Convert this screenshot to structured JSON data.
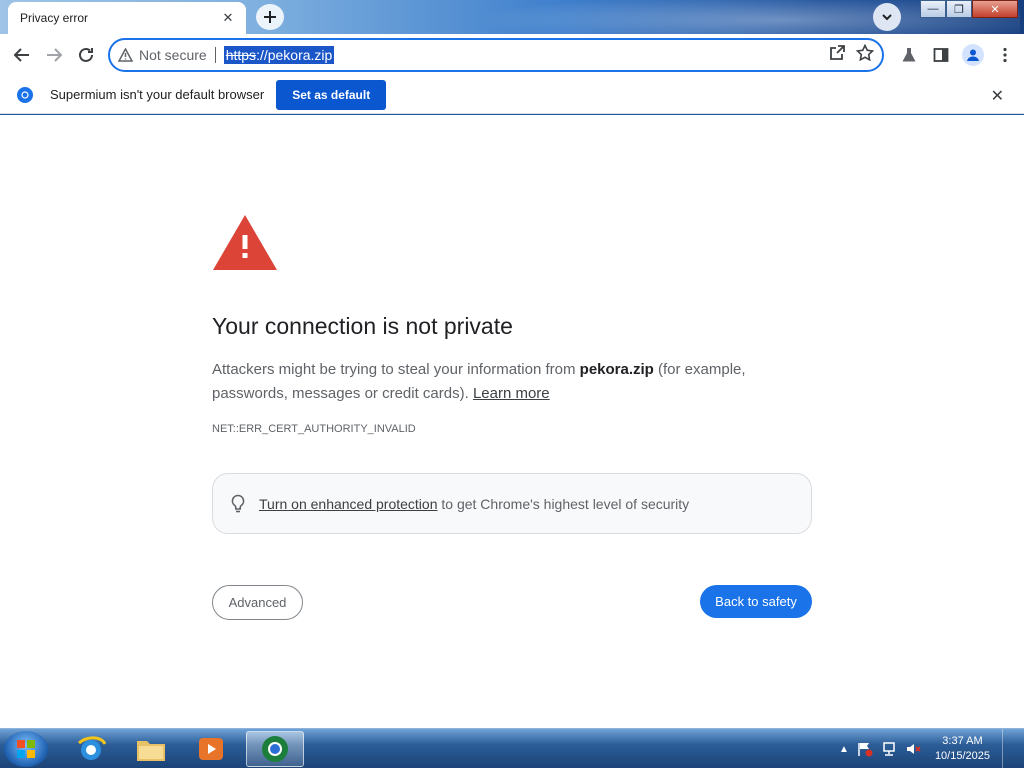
{
  "tab": {
    "title": "Privacy error",
    "close": "✕"
  },
  "window_controls": {
    "minimize": "—",
    "maximize": "❐",
    "close": "✕"
  },
  "omnibox": {
    "security_label": "Not secure",
    "url_scheme": "https",
    "url_rest": "://pekora.zip"
  },
  "infobar": {
    "message": "Supermium isn't your default browser",
    "button": "Set as default",
    "close": "✕"
  },
  "page": {
    "heading": "Your connection is not private",
    "desc_before": "Attackers might be trying to steal your information from ",
    "desc_domain": "pekora.zip",
    "desc_after": " (for example, passwords, messages or credit cards). ",
    "learn_more": "Learn more",
    "error_code": "NET::ERR_CERT_AUTHORITY_INVALID",
    "tip_link": "Turn on enhanced protection",
    "tip_rest": " to get Chrome's highest level of security",
    "advanced_button": "Advanced",
    "back_button": "Back to safety"
  },
  "taskbar": {
    "time": "3:37 AM",
    "date": "10/15/2025",
    "tray_arrow": "▲"
  },
  "colors": {
    "accent": "#1a73e8",
    "warning": "#db4437",
    "infobar_button": "#0b57d0"
  }
}
